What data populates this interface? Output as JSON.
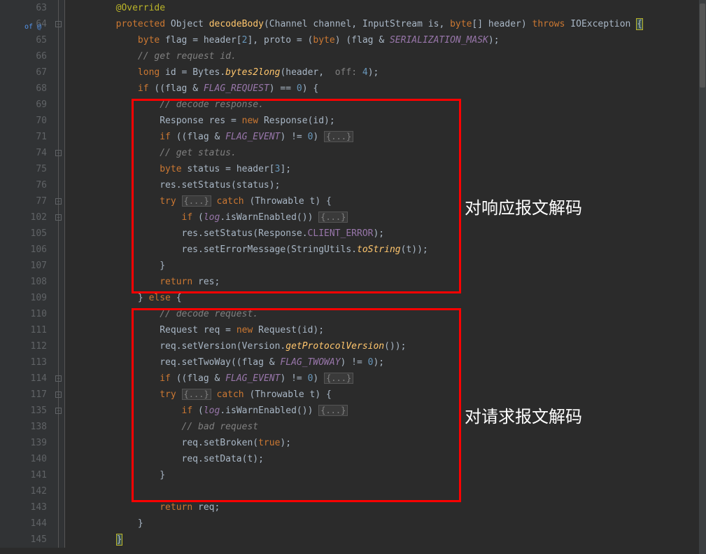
{
  "lineNumbers": [
    "63",
    "64",
    "65",
    "66",
    "67",
    "68",
    "69",
    "70",
    "71",
    "74",
    "75",
    "76",
    "77",
    "102",
    "105",
    "106",
    "107",
    "108",
    "109",
    "110",
    "111",
    "112",
    "113",
    "114",
    "117",
    "135",
    "138",
    "139",
    "140",
    "141",
    "142",
    "143",
    "144",
    "145"
  ],
  "modifiedLine": 1,
  "modifiedMarker": "of @",
  "foldMarks": [
    {
      "line": 1,
      "type": "minus"
    },
    {
      "line": 9,
      "type": "plus"
    },
    {
      "line": 12,
      "type": "plus"
    },
    {
      "line": 13,
      "type": "plus"
    },
    {
      "line": 23,
      "type": "plus"
    },
    {
      "line": 24,
      "type": "plus"
    },
    {
      "line": 25,
      "type": "plus"
    }
  ],
  "code": {
    "l63": {
      "indent": "        ",
      "ann": "@Override"
    },
    "l64": {
      "indent": "        ",
      "kw1": "protected",
      "type1": "Object",
      "fn": "decodeBody",
      "p1": "(Channel channel, InputStream is, ",
      "kw2": "byte",
      "p2": "[] header) ",
      "kw3": "throws",
      "p3": " IOException ",
      "brace": "{"
    },
    "l65": {
      "indent": "            ",
      "kw1": "byte",
      "t1": " flag = header[",
      "num1": "2",
      "t2": "], proto = (",
      "kw2": "byte",
      "t3": ") (flag & ",
      "fld1": "SERIALIZATION_MASK",
      "t4": ");"
    },
    "l66": {
      "indent": "            ",
      "com": "// get request id."
    },
    "l67": {
      "indent": "            ",
      "kw1": "long",
      "t1": " id = Bytes.",
      "fni": "bytes2long",
      "t2": "(header, ",
      "param": " off:",
      "t3": " ",
      "num1": "4",
      "t4": ");"
    },
    "l68": {
      "indent": "            ",
      "kw1": "if",
      "t1": " ((flag & ",
      "fld1": "FLAG_REQUEST",
      "t2": ") == ",
      "num1": "0",
      "t3": ") {"
    },
    "l69": {
      "indent": "                ",
      "com": "// decode response."
    },
    "l70": {
      "indent": "                ",
      "t1": "Response res = ",
      "kw1": "new",
      "t2": " Response(id);"
    },
    "l71": {
      "indent": "                ",
      "kw1": "if",
      "t1": " ((flag & ",
      "fld1": "FLAG_EVENT",
      "t2": ") != ",
      "num1": "0",
      "t3": ") ",
      "fold": "{...}"
    },
    "l74": {
      "indent": "                ",
      "com": "// get status."
    },
    "l75": {
      "indent": "                ",
      "kw1": "byte",
      "t1": " status = header[",
      "num1": "3",
      "t2": "];"
    },
    "l76": {
      "indent": "                ",
      "t1": "res.setStatus(status);"
    },
    "l77": {
      "indent": "                ",
      "kw1": "try",
      "t1": " ",
      "fold": "{...}",
      "t2": " ",
      "kw2": "catch",
      "t3": " (Throwable t) {"
    },
    "l102": {
      "indent": "                    ",
      "kw1": "if",
      "t1": " (",
      "fld1": "log",
      "t2": ".isWarnEnabled()) ",
      "fold": "{...}"
    },
    "l105": {
      "indent": "                    ",
      "t1": "res.setStatus(Response.",
      "fld1": "CLIENT_ERROR",
      "t2": ");"
    },
    "l106": {
      "indent": "                    ",
      "t1": "res.setErrorMessage(StringUtils.",
      "fni": "toString",
      "t2": "(t));"
    },
    "l107": {
      "indent": "                ",
      "t1": "}"
    },
    "l108": {
      "indent": "                ",
      "kw1": "return",
      "t1": " res;"
    },
    "l109": {
      "indent": "            ",
      "t1": "} ",
      "kw1": "else",
      "t2": " {"
    },
    "l110": {
      "indent": "                ",
      "com": "// decode request."
    },
    "l111": {
      "indent": "                ",
      "t1": "Request req = ",
      "kw1": "new",
      "t2": " Request(id);"
    },
    "l112": {
      "indent": "                ",
      "t1": "req.setVersion(Version.",
      "fni": "getProtocolVersion",
      "t2": "());"
    },
    "l113": {
      "indent": "                ",
      "t1": "req.setTwoWay((flag & ",
      "fld1": "FLAG_TWOWAY",
      "t2": ") != ",
      "num1": "0",
      "t3": ");"
    },
    "l114": {
      "indent": "                ",
      "kw1": "if",
      "t1": " ((flag & ",
      "fld1": "FLAG_EVENT",
      "t2": ") != ",
      "num1": "0",
      "t3": ") ",
      "fold": "{...}"
    },
    "l117": {
      "indent": "                ",
      "kw1": "try",
      "t1": " ",
      "fold": "{...}",
      "t2": " ",
      "kw2": "catch",
      "t3": " (Throwable t) {"
    },
    "l135": {
      "indent": "                    ",
      "kw1": "if",
      "t1": " (",
      "fld1": "log",
      "t2": ".isWarnEnabled()) ",
      "fold": "{...}"
    },
    "l138": {
      "indent": "                    ",
      "com": "// bad request"
    },
    "l139": {
      "indent": "                    ",
      "t1": "req.setBroken(",
      "kw1": "true",
      "t2": ");"
    },
    "l140": {
      "indent": "                    ",
      "t1": "req.setData(t);"
    },
    "l141": {
      "indent": "                ",
      "t1": "}"
    },
    "l142": {
      "indent": ""
    },
    "l143": {
      "indent": "                ",
      "kw1": "return",
      "t1": " req;"
    },
    "l144": {
      "indent": "            ",
      "t1": "}"
    },
    "l145": {
      "indent": "        ",
      "brace": "}"
    }
  },
  "annotations": {
    "response": "对响应报文解码",
    "request": "对请求报文解码"
  }
}
